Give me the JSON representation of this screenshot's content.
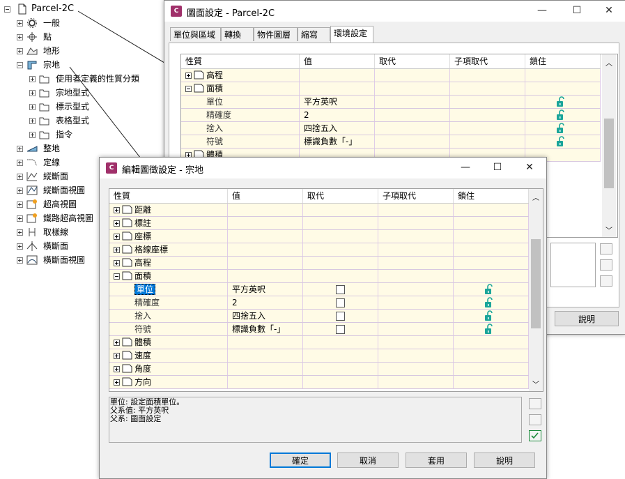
{
  "tree": {
    "root": "Parcel-2C",
    "items": [
      {
        "label": "一般",
        "icon": "gear-icon",
        "level": 1,
        "expanded": false
      },
      {
        "label": "點",
        "icon": "point-icon",
        "level": 1,
        "expanded": false
      },
      {
        "label": "地形",
        "icon": "surface-icon",
        "level": 1,
        "expanded": false
      },
      {
        "label": "宗地",
        "icon": "parcel-icon",
        "level": 1,
        "expanded": true
      },
      {
        "label": "使用者定義的性質分類",
        "icon": "folder-icon",
        "level": 2,
        "expanded": false
      },
      {
        "label": "宗地型式",
        "icon": "folder-icon",
        "level": 2,
        "expanded": false
      },
      {
        "label": "標示型式",
        "icon": "folder-icon",
        "level": 2,
        "expanded": false
      },
      {
        "label": "表格型式",
        "icon": "folder-icon",
        "level": 2,
        "expanded": false
      },
      {
        "label": "指令",
        "icon": "folder-icon",
        "level": 2,
        "expanded": false
      },
      {
        "label": "整地",
        "icon": "grading-icon",
        "level": 1,
        "expanded": false
      },
      {
        "label": "定線",
        "icon": "alignment-icon",
        "level": 1,
        "expanded": false
      },
      {
        "label": "縱斷面",
        "icon": "profile-icon",
        "level": 1,
        "expanded": false
      },
      {
        "label": "縱斷面視圖",
        "icon": "profile-view-icon",
        "level": 1,
        "expanded": false
      },
      {
        "label": "超高視圖",
        "icon": "superelevation-icon",
        "level": 1,
        "expanded": false
      },
      {
        "label": "鐵路超高視圖",
        "icon": "rail-superelevation-icon",
        "level": 1,
        "expanded": false
      },
      {
        "label": "取樣線",
        "icon": "sample-line-icon",
        "level": 1,
        "expanded": false
      },
      {
        "label": "橫斷面",
        "icon": "section-icon",
        "level": 1,
        "expanded": false
      },
      {
        "label": "橫斷面視圖",
        "icon": "section-view-icon",
        "level": 1,
        "expanded": false
      }
    ]
  },
  "drawing_settings": {
    "title": "圖面設定 - Parcel-2C",
    "app_icon_text": "C",
    "tabs": [
      "單位與區域",
      "轉換",
      "物件圖層",
      "縮寫",
      "環境設定"
    ],
    "active_tab": 4,
    "columns": [
      "性質",
      "值",
      "取代",
      "子項取代",
      "鎖住"
    ],
    "rows": [
      {
        "type": "section",
        "label": "高程",
        "expanded": false
      },
      {
        "type": "section",
        "label": "面積",
        "expanded": true
      },
      {
        "type": "prop",
        "label": "單位",
        "value": "平方英呎",
        "locked": false
      },
      {
        "type": "prop",
        "label": "精確度",
        "value": "2",
        "locked": false
      },
      {
        "type": "prop",
        "label": "捨入",
        "value": "四捨五入",
        "locked": false
      },
      {
        "type": "prop",
        "label": "符號",
        "value": "標識負數「-」",
        "locked": false
      },
      {
        "type": "section",
        "label": "體積",
        "expanded": false
      }
    ],
    "help_button": "說明",
    "controls": {
      "minimize": "—",
      "maximize": "☐",
      "close": "✕"
    }
  },
  "edit_settings": {
    "title": "編輯圖徵設定 - 宗地",
    "app_icon_text": "C",
    "columns": [
      "性質",
      "值",
      "取代",
      "子項取代",
      "鎖住"
    ],
    "rows": [
      {
        "type": "section",
        "label": "距離",
        "expanded": false
      },
      {
        "type": "section",
        "label": "標註",
        "expanded": false
      },
      {
        "type": "section",
        "label": "座標",
        "expanded": false
      },
      {
        "type": "section",
        "label": "格線座標",
        "expanded": false
      },
      {
        "type": "section",
        "label": "高程",
        "expanded": false
      },
      {
        "type": "section",
        "label": "面積",
        "expanded": true
      },
      {
        "type": "prop",
        "label": "單位",
        "value": "平方英呎",
        "override": false,
        "locked": false,
        "selected": true
      },
      {
        "type": "prop",
        "label": "精確度",
        "value": "2",
        "override": false,
        "locked": false
      },
      {
        "type": "prop",
        "label": "捨入",
        "value": "四捨五入",
        "override": false,
        "locked": false
      },
      {
        "type": "prop",
        "label": "符號",
        "value": "標識負數「-」",
        "override": false,
        "locked": false
      },
      {
        "type": "section",
        "label": "體積",
        "expanded": false
      },
      {
        "type": "section",
        "label": "速度",
        "expanded": false
      },
      {
        "type": "section",
        "label": "角度",
        "expanded": false
      },
      {
        "type": "section",
        "label": "方向",
        "expanded": false
      }
    ],
    "description": [
      "單位: 設定面積單位。",
      "父系值: 平方英呎",
      "父系: 圖面設定"
    ],
    "buttons": {
      "ok": "確定",
      "cancel": "取消",
      "apply": "套用",
      "help": "說明"
    },
    "controls": {
      "minimize": "—",
      "maximize": "☐",
      "close": "✕"
    }
  },
  "colors": {
    "row_bg": "#fffbe6",
    "selected": "#0078d7",
    "lock": "#1aa59a",
    "app_icon": "#a0306a"
  }
}
